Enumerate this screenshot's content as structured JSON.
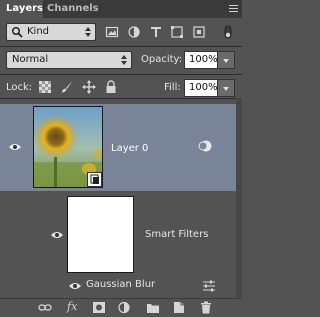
{
  "tabs": {
    "active": "Layers",
    "inactive": "Channels"
  },
  "filter": {
    "kind_label": "Kind"
  },
  "blend": {
    "mode": "Normal",
    "opacity_label": "Opacity:",
    "opacity_value": "100%"
  },
  "lock": {
    "label": "Lock:",
    "fill_label": "Fill:",
    "fill_value": "100%"
  },
  "layers": {
    "layer0_name": "Layer 0",
    "smart_filters_label": "Smart Filters",
    "gaussian_blur_label": "Gaussian Blur"
  },
  "bottom": {
    "fx_label": "fx"
  },
  "colors": {
    "selected_row": "#7a8499",
    "panel_bg": "#535353"
  }
}
